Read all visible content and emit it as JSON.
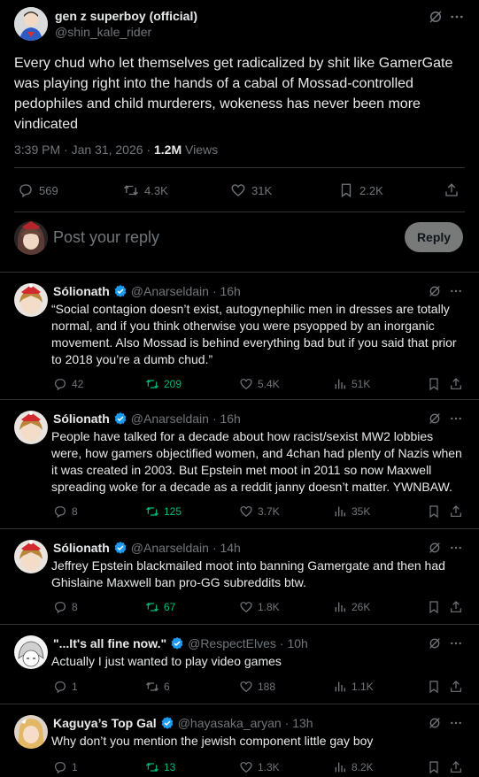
{
  "main_post": {
    "display_name": "gen z superboy (official)",
    "handle": "@shin_kale_rider",
    "text": "Every chud who let themselves get radicalized by shit like GamerGate was playing right into the hands of a cabal of Mossad-controlled pedophiles and child murderers, wokeness has never been more vindicated",
    "timestamp": "3:39 PM · Jan 31, 2026 · ",
    "views_count": "1.2M",
    "views_label": " Views",
    "actions": {
      "replies": "569",
      "reposts": "4.3K",
      "likes": "31K",
      "bookmarks": "2.2K"
    }
  },
  "composer": {
    "placeholder": "Post your reply",
    "button_label": "Reply"
  },
  "replies": [
    {
      "display_name": "Sólionath",
      "handle": "@Anarseldain",
      "time": "· 16h",
      "text": "“Social contagion doesn’t exist, autogynephilic men in dresses are totally normal, and if you think otherwise you were psyopped by an inorganic movement. Also Mossad is behind everything bad but if you said that prior to 2018 you’re a dumb chud.”",
      "replies": "42",
      "reposts": "209",
      "likes": "5.4K",
      "views": "51K"
    },
    {
      "display_name": "Sólionath",
      "handle": "@Anarseldain",
      "time": "· 16h",
      "text": "People have talked for a decade about how racist/sexist MW2 lobbies were, how gamers objectified women, and 4chan had plenty of Nazis when it was created in 2003. But Epstein met moot in 2011 so now Maxwell spreading woke for a decade as a reddit janny doesn’t matter. YWNBAW.",
      "replies": "8",
      "reposts": "125",
      "likes": "3.7K",
      "views": "35K"
    },
    {
      "display_name": "Sólionath",
      "handle": "@Anarseldain",
      "time": "· 14h",
      "text": "Jeffrey Epstein blackmailed moot into banning Gamergate and then had Ghislaine Maxwell ban pro-GG subreddits btw.",
      "replies": "8",
      "reposts": "67",
      "likes": "1.8K",
      "views": "26K"
    },
    {
      "display_name": "\"...It's all fine now.\"",
      "handle": "@RespectElves",
      "time": "· 10h",
      "text": "Actually I just wanted to play video games",
      "replies": "1",
      "reposts": "6",
      "likes": "188",
      "views": "1.1K"
    },
    {
      "display_name": "Kaguya’s Top Gal",
      "handle": "@hayasaka_aryan",
      "time": "· 13h",
      "text": "Why don’t you mention the jewish component little gay boy",
      "replies": "1",
      "reposts": "13",
      "likes": "1.3K",
      "views": "8.2K"
    }
  ],
  "colors": {
    "background": "#000000",
    "text": "#e7e9ea",
    "muted": "#71767b",
    "border": "#2f3336",
    "verified": "#1d9bf0",
    "repost_active": "#00ba7c"
  },
  "icons": [
    "grok-icon",
    "more-icon",
    "reply-icon",
    "repost-icon",
    "like-icon",
    "bookmark-icon",
    "share-icon",
    "views-icon",
    "verified-badge-icon"
  ]
}
